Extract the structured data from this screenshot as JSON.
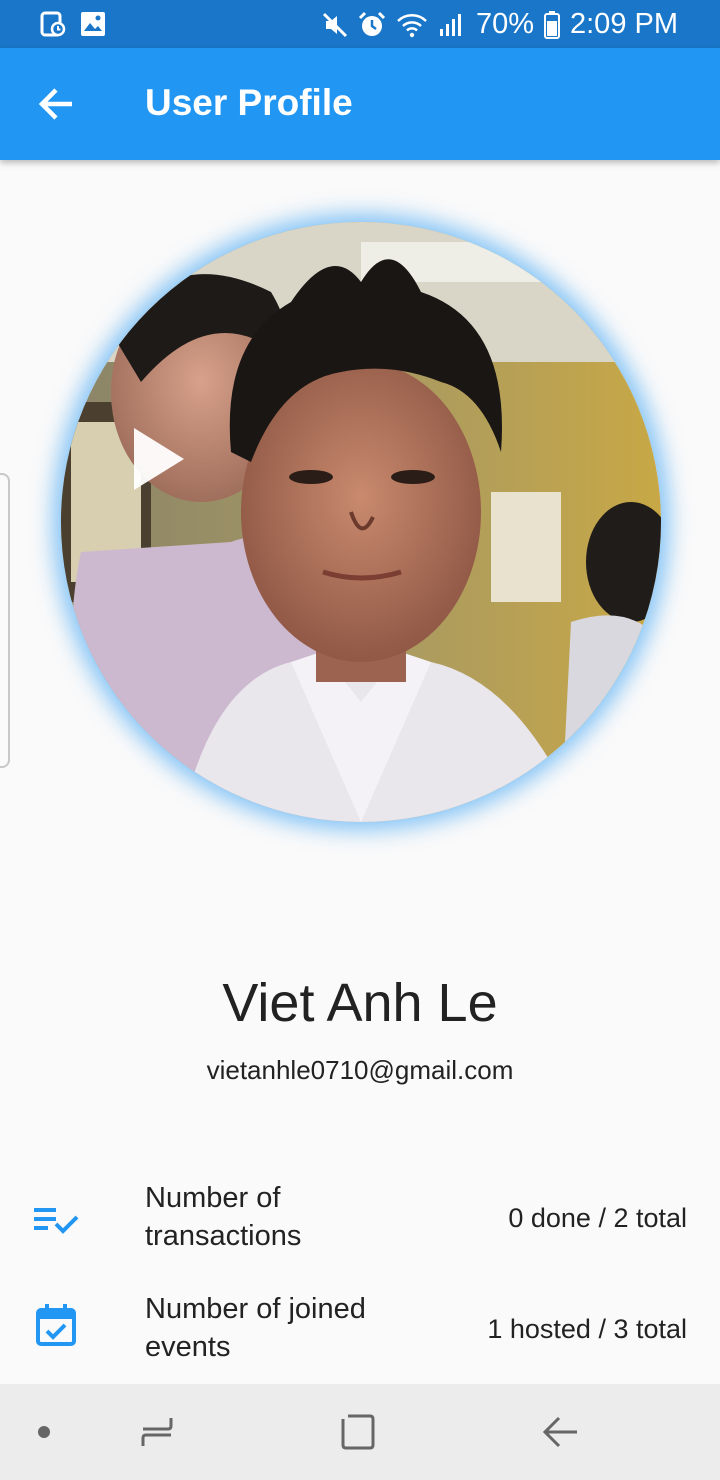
{
  "status_bar": {
    "battery": "70%",
    "time": "2:09 PM"
  },
  "app_bar": {
    "title": "User Profile"
  },
  "profile": {
    "name": "Viet Anh Le",
    "email": "vietanhle0710@gmail.com"
  },
  "stats": [
    {
      "icon": "playlist-check-icon",
      "label": "Number of transactions",
      "value": "0 done / 2 total"
    },
    {
      "icon": "calendar-check-icon",
      "label": "Number of joined events",
      "value": "1 hosted / 3 total"
    }
  ],
  "colors": {
    "primary": "#2196f3",
    "status_bar": "#1976c8",
    "icon_accent": "#2196f3"
  }
}
